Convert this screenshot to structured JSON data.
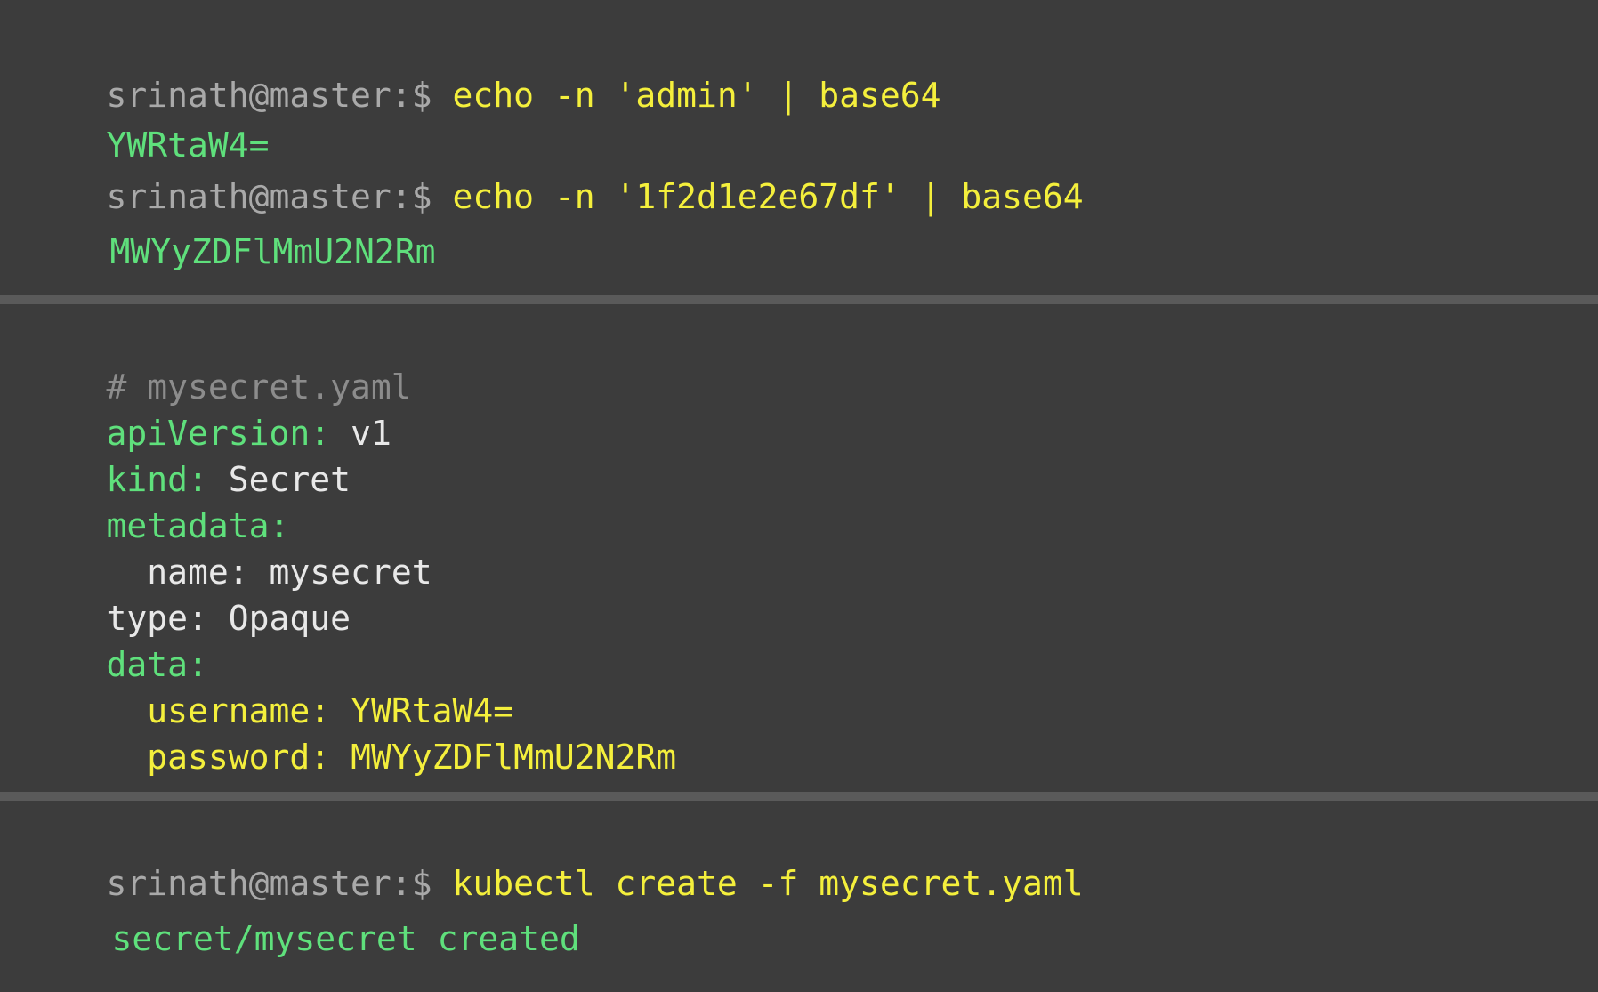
{
  "terminal1": {
    "lines": [
      {
        "prompt": "srinath@master:$",
        "command": " echo -n 'admin' | base64"
      },
      {
        "output": "YWRtaW4="
      },
      {
        "prompt": "srinath@master:$",
        "command": " echo -n '1f2d1e2e67df' | base64"
      },
      {
        "output": "MWYyZDFlMmU2N2Rm"
      }
    ]
  },
  "yaml": {
    "comment": "# mysecret.yaml",
    "api_key": "apiVersion:",
    "api_val": " v1",
    "kind_key": "kind:",
    "kind_val": " Secret",
    "metadata_key": "metadata:",
    "name_key": "  name:",
    "name_val": " mysecret",
    "type_key": "type:",
    "type_val": " Opaque",
    "data_key": "data:",
    "username_key": "  username:",
    "username_val": " YWRtaW4=",
    "password_key": "  password:",
    "password_val": " MWYyZDFlMmU2N2Rm"
  },
  "terminal2": {
    "prompt": "srinath@master:$",
    "command": " kubectl create -f mysecret.yaml",
    "output": "secret/mysecret created"
  },
  "colors": {
    "background": "#3c3c3c",
    "separator": "#5a5a5a",
    "prompt": "#a9a9a9",
    "command": "#f4ef3c",
    "output": "#5fe07c",
    "comment": "#8c8c8c",
    "text": "#e8e8e8"
  }
}
